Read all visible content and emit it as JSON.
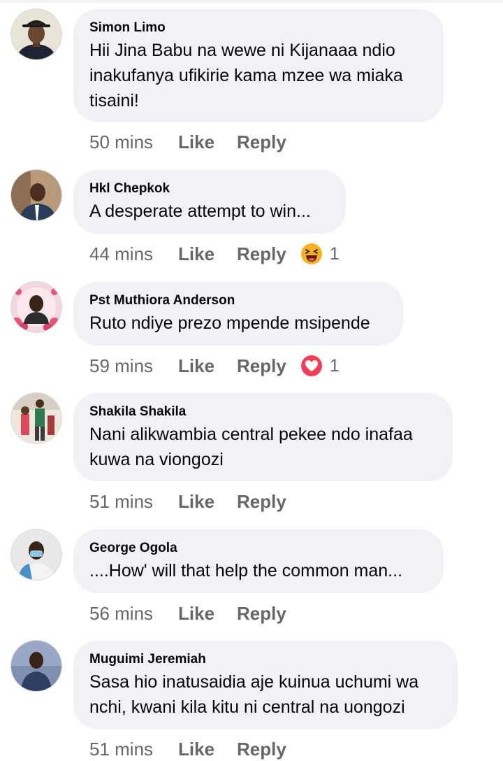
{
  "colors": {
    "bubble_bg": "#f0f2f5",
    "meta_text": "#65676b",
    "name_text": "#050505",
    "love_red": "#f33e58",
    "haha_yellow": "#f7b125"
  },
  "comments": [
    {
      "author": "Simon Limo",
      "lines": [
        "Hii Jina Babu na wewe ni Kijanaaa ndio",
        "inakufanya ufikirie kama mzee wa miaka",
        "tisaini!"
      ],
      "time": "50 mins",
      "like": "Like",
      "reply": "Reply"
    },
    {
      "author": "Hkl Chepkok",
      "lines": [
        "A desperate attempt to win..."
      ],
      "time": "44 mins",
      "like": "Like",
      "reply": "Reply",
      "reaction": {
        "icon": "haha-emoji-icon",
        "count": "1"
      }
    },
    {
      "author": "Pst Muthiora Anderson",
      "lines": [
        "Ruto ndiye prezo mpende msipende"
      ],
      "time": "59 mins",
      "like": "Like",
      "reply": "Reply",
      "reaction": {
        "icon": "love-reaction-icon",
        "count": "1"
      }
    },
    {
      "author": "Shakila Shakila",
      "lines": [
        "Nani alikwambia central pekee ndo inafaa",
        "kuwa na viongozi"
      ],
      "time": "51 mins",
      "like": "Like",
      "reply": "Reply"
    },
    {
      "author": "George Ogola",
      "lines": [
        "....How' will that help the common man..."
      ],
      "time": "56 mins",
      "like": "Like",
      "reply": "Reply"
    },
    {
      "author": "Muguimi Jeremiah",
      "lines": [
        "Sasa hio inatusaidia aje kuinua uchumi wa",
        "nchi, kwani kila kitu ni central na uongozi"
      ],
      "time": "51 mins",
      "like": "Like",
      "reply": "Reply"
    }
  ]
}
